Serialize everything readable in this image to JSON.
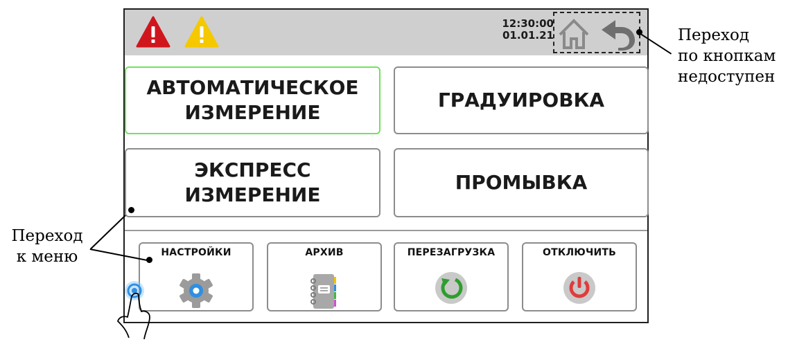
{
  "status_bar": {
    "time": "12:30:00",
    "date": "01.01.21",
    "alarm_icon": "red-warning-triangle",
    "warning_icon": "yellow-warning-triangle",
    "home_icon": "home-icon",
    "back_icon": "back-arrow-icon"
  },
  "menu": {
    "auto_measure": "АВТОМАТИЧЕСКОЕ\nИЗМЕРЕНИЕ",
    "calibration": "ГРАДУИРОВКА",
    "express_measure": "ЭКСПРЕСС\nИЗМЕРЕНИЕ",
    "flush": "ПРОМЫВКА"
  },
  "bottom_buttons": {
    "settings": "НАСТРОЙКИ",
    "archive": "АРХИВ",
    "reboot": "ПЕРЕЗАГРУЗКА",
    "shutdown": "ОТКЛЮЧИТЬ"
  },
  "annotations": {
    "nav_unavailable": [
      "Переход",
      "по кнопкам",
      "недоступен"
    ],
    "menu_transition": [
      "Переход",
      "к меню"
    ]
  },
  "colors": {
    "alarm": "#d0161d",
    "warning": "#f5c800",
    "active_border": "#6ee35a",
    "settings_gear": "#9b9b9b",
    "settings_center": "#2f8fe0",
    "reboot_arrow": "#2e9e2e",
    "shutdown": "#e03c3c"
  }
}
